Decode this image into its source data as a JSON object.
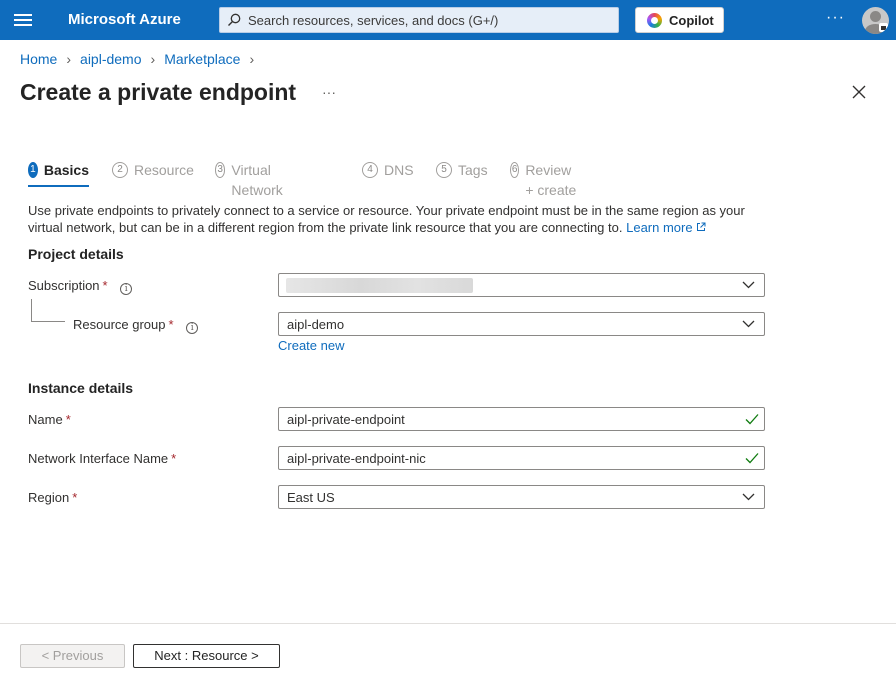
{
  "topbar": {
    "brand": "Microsoft Azure",
    "search_placeholder": "Search resources, services, and docs (G+/)",
    "copilot_label": "Copilot",
    "more_label": "···",
    "icons": [
      "hamburger-icon",
      "search-icon",
      "copilot-icon",
      "more-icon",
      "avatar-icon"
    ]
  },
  "breadcrumb": [
    "Home",
    "aipl-demo",
    "Marketplace"
  ],
  "page": {
    "title": "Create a private endpoint",
    "more_label": "···"
  },
  "tabs": [
    {
      "num": "1",
      "label": "Basics",
      "active": true
    },
    {
      "num": "2",
      "label": "Resource",
      "active": false
    },
    {
      "num": "3",
      "label": "Virtual Network",
      "active": false
    },
    {
      "num": "4",
      "label": "DNS",
      "active": false
    },
    {
      "num": "5",
      "label": "Tags",
      "active": false
    },
    {
      "num": "6",
      "label": "Review + create",
      "active": false
    }
  ],
  "intro": {
    "text": "Use private endpoints to privately connect to a service or resource. Your private endpoint must be in the same region as your virtual network, but can be in a different region from the private link resource that you are connecting to.",
    "learn_more": "Learn more"
  },
  "project": {
    "heading": "Project details",
    "subscription_label": "Subscription",
    "resource_group_label": "Resource group",
    "resource_group_value": "aipl-demo",
    "create_new": "Create new"
  },
  "instance": {
    "heading": "Instance details",
    "name_label": "Name",
    "name_value": "aipl-private-endpoint",
    "nic_label": "Network Interface Name",
    "nic_value": "aipl-private-endpoint-nic",
    "region_label": "Region",
    "region_value": "East US"
  },
  "required_mark": "*",
  "info_mark": "i",
  "footer": {
    "previous": "< Previous",
    "next": "Next : Resource >"
  },
  "colors": {
    "accent": "#0f6cbd",
    "required": "#a4262c",
    "valid_check": "#107c10"
  }
}
